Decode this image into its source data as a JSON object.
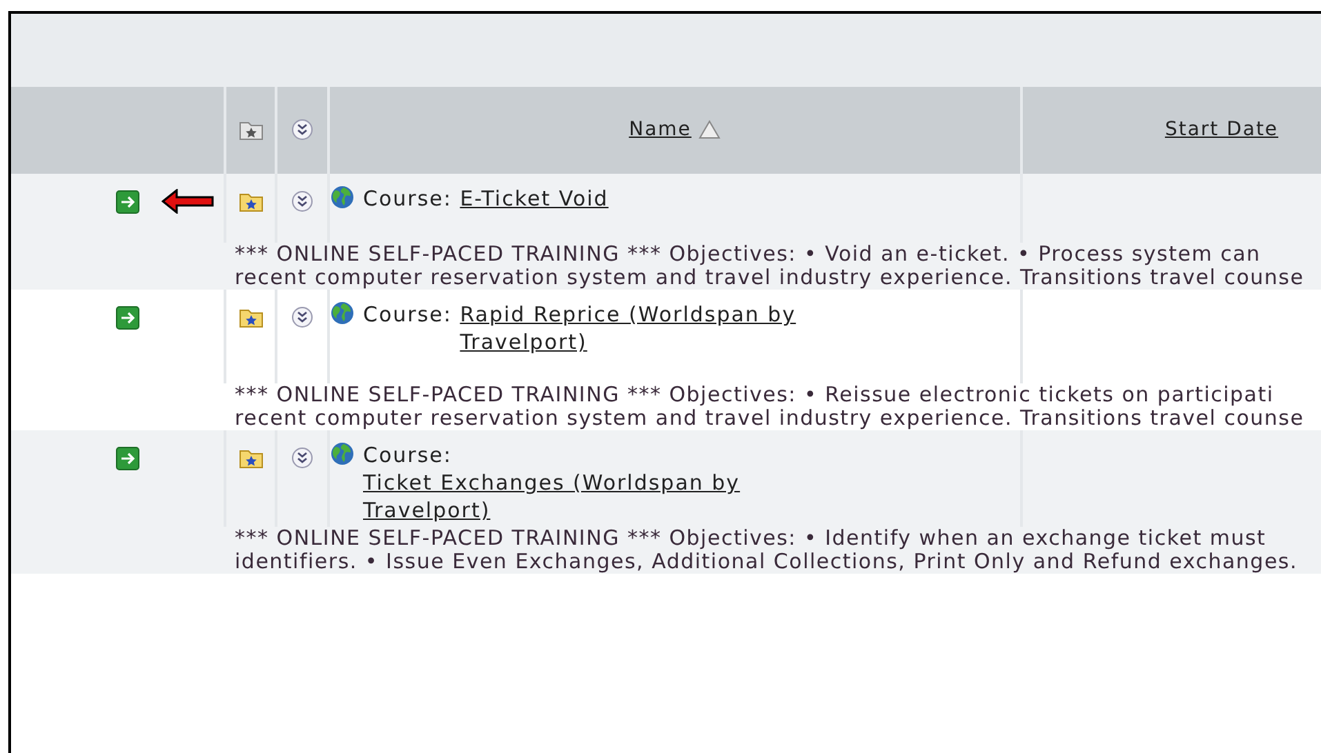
{
  "columns": [
    {
      "label": "Name",
      "sorted": true
    },
    {
      "label": "Start Date",
      "sorted": false
    }
  ],
  "rows": [
    {
      "pointed": true,
      "prefix": "Course:",
      "title": "E-Ticket Void",
      "description": [
        "*** ONLINE SELF-PACED TRAINING *** Objectives: • Void an e-ticket. • Process system can",
        "recent computer reservation system and travel industry experience. Transitions travel counse"
      ]
    },
    {
      "pointed": false,
      "prefix": "Course:",
      "title": "Rapid Reprice (Worldspan by Travelport)",
      "description": [
        "*** ONLINE SELF-PACED TRAINING *** Objectives: • Reissue electronic tickets on participati",
        "recent computer reservation system and travel industry experience. Transitions travel counse"
      ]
    },
    {
      "pointed": false,
      "prefix": "Course:",
      "title": "Ticket Exchanges (Worldspan by Travelport)",
      "description": [
        "*** ONLINE SELF-PACED TRAINING *** Objectives: • Identify when an exchange ticket must",
        "identifiers. • Issue Even Exchanges, Additional Collections, Print Only and Refund exchanges."
      ]
    }
  ]
}
